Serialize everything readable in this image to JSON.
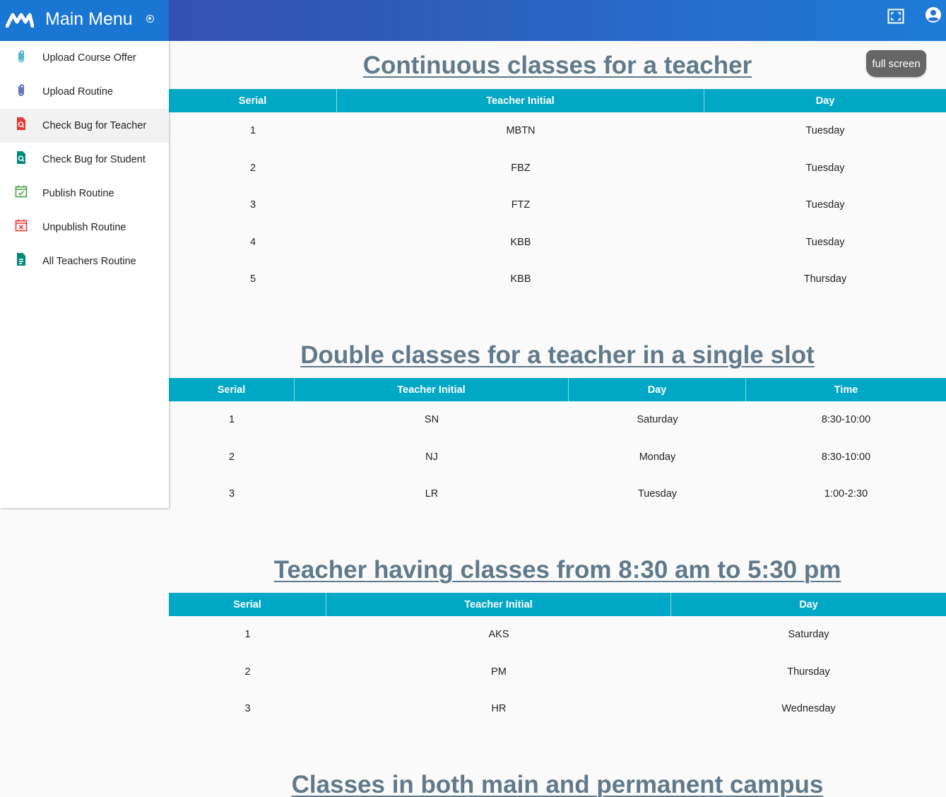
{
  "header": {
    "title": "Main Menu",
    "icons": [
      "logo-icon",
      "radio-icon",
      "fullscreen-icon",
      "account-circle-icon"
    ]
  },
  "full_screen_label": "full screen",
  "sidebar": {
    "items": [
      {
        "label": "Upload Course Offer",
        "icon": "paperclip-icon",
        "color": "#26a6c6"
      },
      {
        "label": "Upload Routine",
        "icon": "paperclip-icon",
        "color": "#3f51b5"
      },
      {
        "label": "Check Bug for Teacher",
        "icon": "file-search-icon",
        "color": "#e53935"
      },
      {
        "label": "Check Bug for Student",
        "icon": "file-search-icon",
        "color": "#00897b"
      },
      {
        "label": "Publish Routine",
        "icon": "calendar-check-icon",
        "color": "#43a047"
      },
      {
        "label": "Unpublish Routine",
        "icon": "calendar-remove-icon",
        "color": "#e53935"
      },
      {
        "label": "All Teachers Routine",
        "icon": "file-document-icon",
        "color": "#00897b"
      }
    ]
  },
  "sections": [
    {
      "title": "Continuous classes for a teacher",
      "columns": [
        "Serial",
        "Teacher Initial",
        "Day"
      ],
      "rows": [
        [
          "1",
          "MBTN",
          "Tuesday"
        ],
        [
          "2",
          "FBZ",
          "Tuesday"
        ],
        [
          "3",
          "FTZ",
          "Tuesday"
        ],
        [
          "4",
          "KBB",
          "Tuesday"
        ],
        [
          "5",
          "KBB",
          "Thursday"
        ]
      ]
    },
    {
      "title": "Double classes for a teacher in a single slot",
      "columns": [
        "Serial",
        "Teacher Initial",
        "Day",
        "Time"
      ],
      "rows": [
        [
          "1",
          "SN",
          "Saturday",
          "8:30-10:00"
        ],
        [
          "2",
          "NJ",
          "Monday",
          "8:30-10:00"
        ],
        [
          "3",
          "LR",
          "Tuesday",
          "1:00-2:30"
        ]
      ]
    },
    {
      "title": "Teacher having classes from 8:30 am to 5:30 pm",
      "columns": [
        "Serial",
        "Teacher Initial",
        "Day"
      ],
      "rows": [
        [
          "1",
          "AKS",
          "Saturday"
        ],
        [
          "2",
          "PM",
          "Thursday"
        ],
        [
          "3",
          "HR",
          "Wednesday"
        ]
      ]
    },
    {
      "title": "Classes in both main and permanent campus"
    }
  ],
  "colors": {
    "header_accent": "#3949ab",
    "table_header": "#00a8c6",
    "title_text": "#5f7a8c"
  }
}
